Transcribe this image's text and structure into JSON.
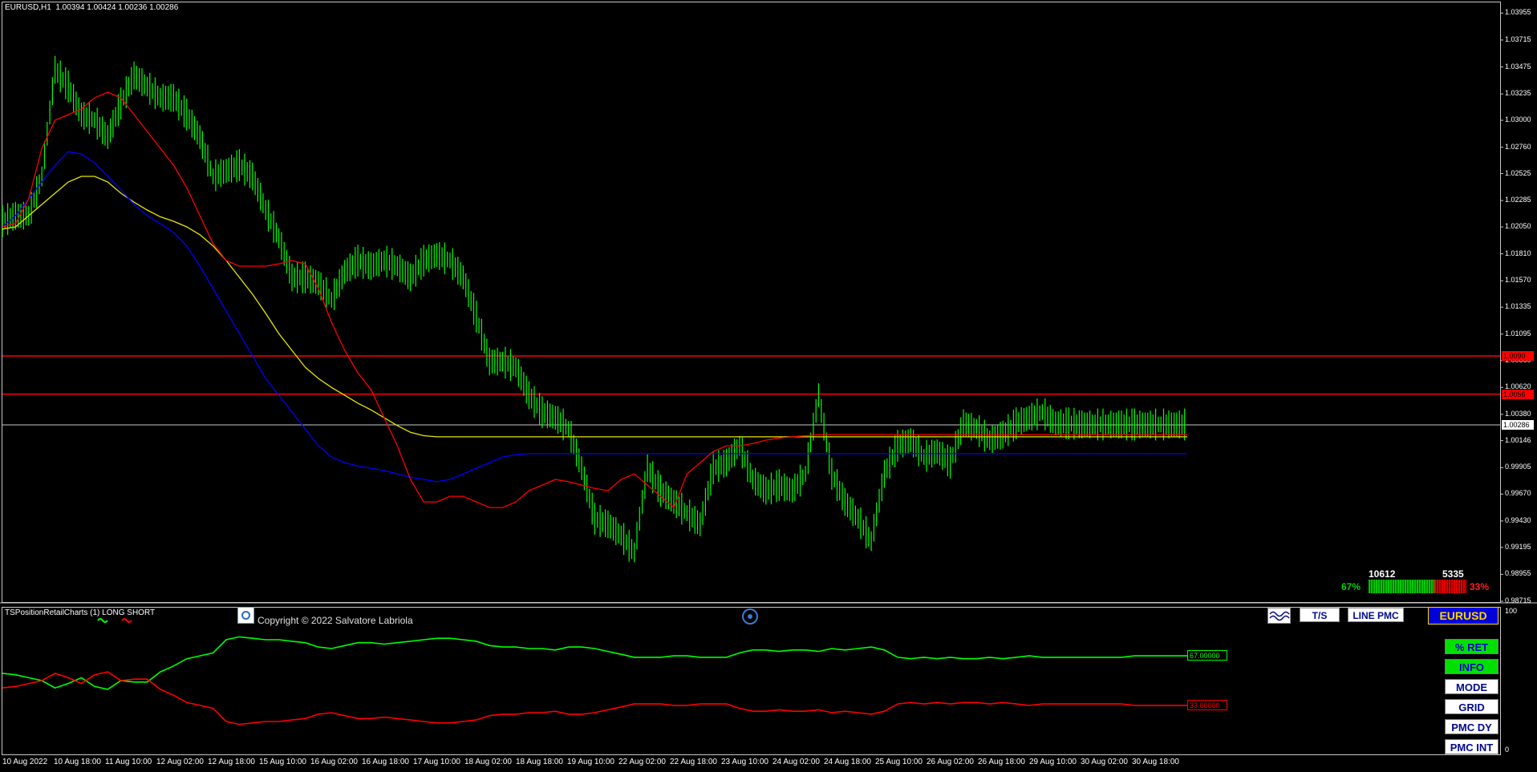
{
  "window": {
    "symbol_header": "EURUSD,H1  1.00394 1.00424 1.00236 1.00286",
    "indicator_label": "TSPositionRetailCharts (1) LONG SHORT",
    "copyright": "Copyright © 2022 Salvatore Labriola",
    "indicator_scale_top": "100",
    "indicator_scale_bottom": "0"
  },
  "toolbar": {
    "ts_label": "T/S",
    "line_pmc_label": "LINE PMC",
    "symbol_label": "EURUSD"
  },
  "side_buttons": [
    {
      "label": "% RET",
      "active": true
    },
    {
      "label": "INFO",
      "active": true
    },
    {
      "label": "MODE",
      "active": false
    },
    {
      "label": "GRID",
      "active": false
    },
    {
      "label": "PMC DY",
      "active": false
    },
    {
      "label": "PMC INT",
      "active": false
    }
  ],
  "stats": {
    "long_count": "10612",
    "short_count": "5335",
    "long_pct": "67%",
    "short_pct": "33%",
    "long_value": "67.00000",
    "short_value": "33.00000"
  },
  "colors": {
    "candle": "#00ff00",
    "ma_fast": "#ff0000",
    "ma_mid": "#0000ff",
    "ma_slow": "#e6e600",
    "level": "#ff0000",
    "long": "#00ff00",
    "short": "#ff0000",
    "last_price_line": "#c8c8c8"
  },
  "chart_data": {
    "type": "line",
    "title": "EURUSD,H1",
    "ylim": [
      0.98715,
      1.0405
    ],
    "x_ticks": [
      "10 Aug 2022",
      "10 Aug 18:00",
      "11 Aug 10:00",
      "12 Aug 02:00",
      "12 Aug 18:00",
      "15 Aug 10:00",
      "16 Aug 02:00",
      "16 Aug 18:00",
      "17 Aug 10:00",
      "18 Aug 02:00",
      "18 Aug 18:00",
      "19 Aug 10:00",
      "22 Aug 02:00",
      "22 Aug 18:00",
      "23 Aug 10:00",
      "24 Aug 02:00",
      "24 Aug 18:00",
      "25 Aug 10:00",
      "26 Aug 02:00",
      "26 Aug 18:00",
      "29 Aug 10:00",
      "30 Aug 02:00",
      "30 Aug 18:00"
    ],
    "y_ticks": [
      "1.03955",
      "1.03715",
      "1.03475",
      "1.03235",
      "1.03000",
      "1.02760",
      "1.02525",
      "1.02285",
      "1.02050",
      "1.01810",
      "1.01570",
      "1.01335",
      "1.01095",
      "1.00860",
      "1.00620",
      "1.00380",
      "1.00146",
      "0.99905",
      "0.99670",
      "0.99430",
      "0.99195",
      "0.98955",
      "0.98715"
    ],
    "horizontal_levels": [
      {
        "name": "resistance_1",
        "value": 1.009,
        "label": "1.0090"
      },
      {
        "name": "resistance_2",
        "value": 1.0056,
        "label": "1.0056"
      }
    ],
    "last_price": {
      "value": 1.00286,
      "label": "1.00286"
    },
    "series": [
      {
        "name": "price",
        "x": [
          0,
          10,
          20,
          30,
          40,
          50,
          60,
          70,
          80,
          90,
          100,
          110,
          120,
          130,
          140,
          150,
          160,
          170,
          180,
          190,
          200,
          210,
          220,
          230,
          240,
          250,
          260,
          270,
          280,
          290,
          300,
          310,
          320,
          330,
          340,
          350,
          360,
          370,
          380,
          390,
          400,
          410,
          420,
          430,
          440,
          450,
          460,
          470,
          480,
          490,
          500,
          510,
          520,
          530,
          540,
          550,
          560,
          570,
          580,
          590,
          600,
          610,
          620,
          630,
          640,
          650,
          660,
          670,
          680,
          690,
          700,
          710,
          720,
          730,
          740,
          750,
          760,
          770,
          780,
          790,
          800,
          810,
          820,
          830,
          840,
          850,
          860,
          870,
          880,
          890,
          900
        ],
        "values": [
          1.021,
          1.0215,
          1.0215,
          1.025,
          1.0345,
          1.033,
          1.0305,
          1.03,
          1.0285,
          1.0315,
          1.034,
          1.033,
          1.032,
          1.032,
          1.0305,
          1.0285,
          1.025,
          1.0255,
          1.026,
          1.025,
          1.022,
          1.0195,
          1.016,
          1.016,
          1.0155,
          1.014,
          1.0165,
          1.0175,
          1.017,
          1.0175,
          1.017,
          1.016,
          1.0175,
          1.018,
          1.0175,
          1.016,
          1.0125,
          1.0085,
          1.0085,
          1.008,
          1.0055,
          1.004,
          1.0035,
          1.0025,
          0.999,
          0.9945,
          0.994,
          0.993,
          0.9915,
          0.999,
          0.997,
          0.996,
          0.995,
          0.994,
          0.999,
          0.9995,
          1.001,
          0.998,
          0.997,
          0.9975,
          0.997,
          0.9985,
          1.0055,
          0.9985,
          0.996,
          0.9945,
          0.9925,
          0.9985,
          1.001,
          1.0015,
          1.0,
          1.0005,
          0.9995,
          1.003,
          1.0025,
          1.0015,
          1.002,
          1.003,
          1.0035,
          1.004,
          1.003,
          1.003,
          1.0029,
          1.0029,
          1.0029,
          1.0029,
          1.0029,
          1.0029,
          1.0029,
          1.0029,
          1.0029
        ]
      },
      {
        "name": "ma_fast",
        "x": [
          0,
          10,
          20,
          30,
          40,
          50,
          60,
          70,
          80,
          90,
          100,
          110,
          120,
          130,
          140,
          150,
          160,
          170,
          180,
          190,
          200,
          210,
          220,
          230,
          240,
          250,
          260,
          270,
          280,
          290,
          300,
          310,
          320,
          330,
          340,
          350,
          360,
          370,
          380,
          390,
          400,
          410,
          420,
          430,
          440,
          450,
          460,
          470,
          480,
          490,
          500,
          510,
          520,
          530,
          540,
          550,
          560,
          570,
          580,
          590,
          600,
          610,
          620,
          630,
          640,
          650,
          660,
          670,
          680,
          690,
          700,
          710,
          720,
          730,
          740,
          750,
          760,
          770,
          780,
          790,
          800,
          810,
          820,
          830,
          840,
          850,
          860,
          870,
          880,
          890,
          900
        ],
        "values": [
          1.0205,
          1.0208,
          1.023,
          1.0275,
          1.03,
          1.0305,
          1.031,
          1.032,
          1.0325,
          1.032,
          1.0305,
          1.029,
          1.0275,
          1.026,
          1.024,
          1.0215,
          1.019,
          1.0175,
          1.017,
          1.017,
          1.017,
          1.0172,
          1.0175,
          1.0172,
          1.015,
          1.012,
          1.0095,
          1.0075,
          1.006,
          1.0035,
          1.001,
          0.998,
          0.996,
          0.996,
          0.9965,
          0.9965,
          0.996,
          0.9955,
          0.9955,
          0.996,
          0.997,
          0.9975,
          0.998,
          0.9978,
          0.9975,
          0.9972,
          0.997,
          0.998,
          0.9985,
          0.9975,
          0.9965,
          0.9955,
          0.9985,
          0.9995,
          1.0005,
          1.001,
          1.001,
          1.0012,
          1.0015,
          1.0017,
          1.0018,
          1.0019,
          1.002,
          1.002,
          1.002,
          1.002,
          1.002,
          1.002,
          1.002,
          1.002,
          1.002,
          1.002,
          1.002,
          1.002,
          1.002,
          1.002,
          1.002,
          1.002,
          1.002,
          1.002,
          1.002,
          1.002,
          1.002,
          1.002,
          1.002,
          1.002,
          1.002,
          1.002,
          1.002,
          1.002,
          1.002
        ]
      },
      {
        "name": "ma_mid",
        "x": [
          0,
          10,
          20,
          30,
          40,
          50,
          60,
          70,
          80,
          90,
          100,
          110,
          120,
          130,
          140,
          150,
          160,
          170,
          180,
          190,
          200,
          210,
          220,
          230,
          240,
          250,
          260,
          270,
          280,
          290,
          300,
          310,
          320,
          330,
          340,
          350,
          360,
          370,
          380,
          390,
          400,
          410,
          420,
          430,
          440,
          450,
          460,
          470,
          480,
          490,
          500,
          510,
          520,
          530,
          540,
          550,
          560,
          570,
          580,
          590,
          600,
          610,
          620,
          630,
          640,
          650,
          660,
          670,
          680,
          690,
          700,
          710,
          720,
          730,
          740,
          750,
          760,
          770,
          780,
          790,
          800,
          810,
          820,
          830,
          840,
          850,
          860,
          870,
          880,
          890,
          900
        ],
        "values": [
          1.0205,
          1.0215,
          1.023,
          1.0245,
          1.026,
          1.0272,
          1.027,
          1.0262,
          1.025,
          1.0238,
          1.0225,
          1.0215,
          1.0208,
          1.02,
          1.0188,
          1.017,
          1.015,
          1.013,
          1.011,
          1.009,
          1.007,
          1.0055,
          1.004,
          1.0025,
          1.001,
          1.0,
          0.9995,
          0.9992,
          0.999,
          0.9988,
          0.9985,
          0.9982,
          0.998,
          0.9978,
          0.998,
          0.9985,
          0.999,
          0.9995,
          1.0,
          1.0002,
          1.0003,
          1.0003,
          1.0003,
          1.0003,
          1.0003,
          1.0003,
          1.0003,
          1.0003,
          1.0003,
          1.0003,
          1.0003,
          1.0003,
          1.0003,
          1.0003,
          1.0003,
          1.0003,
          1.0003,
          1.0003,
          1.0003,
          1.0003,
          1.0003,
          1.0003,
          1.0003,
          1.0003,
          1.0003,
          1.0003,
          1.0003,
          1.0003,
          1.0003,
          1.0003,
          1.0003,
          1.0003,
          1.0003,
          1.0003,
          1.0003,
          1.0003,
          1.0003,
          1.0003,
          1.0003,
          1.0003,
          1.0003,
          1.0003,
          1.0003,
          1.0003,
          1.0003,
          1.0003,
          1.0003,
          1.0003,
          1.0003,
          1.0003,
          1.0003
        ]
      },
      {
        "name": "ma_slow",
        "x": [
          0,
          10,
          20,
          30,
          40,
          50,
          60,
          70,
          80,
          90,
          100,
          110,
          120,
          130,
          140,
          150,
          160,
          170,
          180,
          190,
          200,
          210,
          220,
          230,
          240,
          250,
          260,
          270,
          280,
          290,
          300,
          310,
          320,
          330,
          340,
          350,
          360,
          370,
          380,
          390,
          400,
          410,
          420,
          430,
          440,
          450,
          460,
          470,
          480,
          490,
          500,
          510,
          520,
          530,
          540,
          550,
          560,
          570,
          580,
          590,
          600,
          610,
          620,
          630,
          640,
          650,
          660,
          670,
          680,
          690,
          700,
          710,
          720,
          730,
          740,
          750,
          760,
          770,
          780,
          790,
          800,
          810,
          820,
          830,
          840,
          850,
          860,
          870,
          880,
          890,
          900
        ],
        "values": [
          1.0203,
          1.0205,
          1.0215,
          1.0225,
          1.0235,
          1.0245,
          1.025,
          1.025,
          1.0245,
          1.0235,
          1.0227,
          1.022,
          1.0214,
          1.021,
          1.0205,
          1.0198,
          1.0188,
          1.0175,
          1.016,
          1.0145,
          1.0128,
          1.011,
          1.0095,
          1.008,
          1.007,
          1.0062,
          1.0055,
          1.0048,
          1.0042,
          1.0035,
          1.0028,
          1.0022,
          1.0019,
          1.0018,
          1.0018,
          1.0018,
          1.0018,
          1.0018,
          1.0018,
          1.0018,
          1.0018,
          1.0018,
          1.0018,
          1.0018,
          1.0018,
          1.0018,
          1.0018,
          1.0018,
          1.0018,
          1.0018,
          1.0018,
          1.0018,
          1.0018,
          1.0018,
          1.0018,
          1.0018,
          1.0018,
          1.0018,
          1.0018,
          1.0018,
          1.0018,
          1.0018,
          1.0018,
          1.0018,
          1.0018,
          1.0018,
          1.0018,
          1.0018,
          1.0018,
          1.0018,
          1.0018,
          1.0018,
          1.0018,
          1.0018,
          1.0018,
          1.0018,
          1.0018,
          1.0018,
          1.0018,
          1.0018,
          1.0018,
          1.0018,
          1.0018,
          1.0018,
          1.0018,
          1.0018,
          1.0018,
          1.0018,
          1.0018,
          1.0018,
          1.0018
        ]
      },
      {
        "name": "long_pct",
        "x": [
          0,
          10,
          20,
          30,
          40,
          50,
          60,
          70,
          80,
          90,
          100,
          110,
          120,
          130,
          140,
          150,
          160,
          170,
          180,
          190,
          200,
          210,
          220,
          230,
          240,
          250,
          260,
          270,
          280,
          290,
          300,
          310,
          320,
          330,
          340,
          350,
          360,
          370,
          380,
          390,
          400,
          410,
          420,
          430,
          440,
          450,
          460,
          470,
          480,
          490,
          500,
          510,
          520,
          530,
          540,
          550,
          560,
          570,
          580,
          590,
          600,
          610,
          620,
          630,
          640,
          650,
          660,
          670,
          680,
          690,
          700,
          710,
          720,
          730,
          740,
          750,
          760,
          770,
          780,
          790,
          800,
          810,
          820,
          830,
          840,
          850,
          860,
          870,
          880,
          890,
          900
        ],
        "values": [
          55,
          54,
          52,
          50,
          45,
          48,
          52,
          46,
          44,
          50,
          49,
          49,
          56,
          60,
          65,
          67,
          69,
          78,
          80,
          79,
          78,
          78,
          77,
          76,
          73,
          72,
          74,
          76,
          76,
          75,
          76,
          77,
          78,
          79,
          79,
          78,
          77,
          74,
          73,
          73,
          72,
          72,
          71,
          73,
          73,
          72,
          70,
          68,
          66,
          66,
          66,
          67,
          67,
          66,
          66,
          66,
          69,
          71,
          71,
          70,
          71,
          71,
          70,
          72,
          71,
          72,
          73,
          71,
          66,
          65,
          66,
          65,
          66,
          65,
          65,
          66,
          65,
          66,
          67,
          66,
          66,
          66,
          66,
          66,
          66,
          66,
          67,
          67,
          67,
          67,
          67
        ]
      }
    ]
  }
}
